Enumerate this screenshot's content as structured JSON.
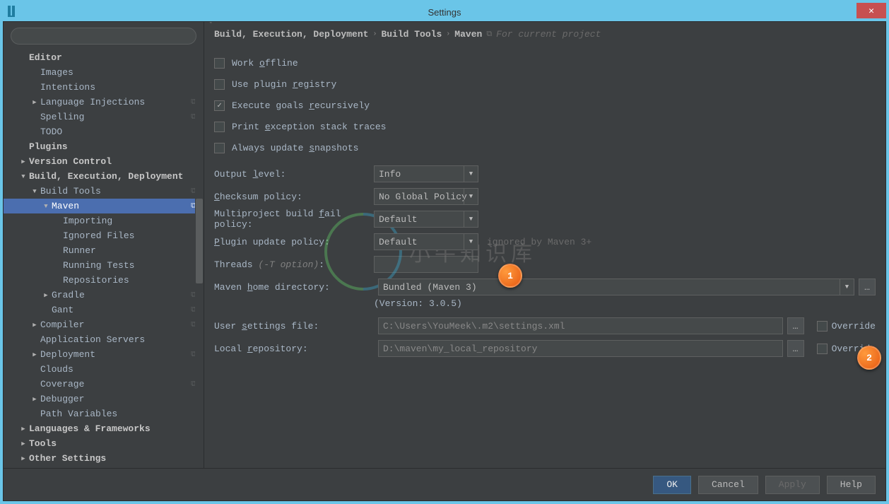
{
  "window": {
    "title": "Settings",
    "close": "✕"
  },
  "search": {
    "placeholder": ""
  },
  "tree": [
    {
      "indent": 1,
      "arrow": "",
      "label": "Editor",
      "bold": true
    },
    {
      "indent": 2,
      "arrow": "",
      "label": "Images"
    },
    {
      "indent": 2,
      "arrow": "",
      "label": "Intentions"
    },
    {
      "indent": 2,
      "arrow": "▶",
      "label": "Language Injections",
      "copy": true
    },
    {
      "indent": 2,
      "arrow": "",
      "label": "Spelling",
      "copy": true
    },
    {
      "indent": 2,
      "arrow": "",
      "label": "TODO"
    },
    {
      "indent": 1,
      "arrow": "",
      "label": "Plugins",
      "bold": true
    },
    {
      "indent": 1,
      "arrow": "▶",
      "label": "Version Control",
      "bold": true
    },
    {
      "indent": 1,
      "arrow": "▼",
      "label": "Build, Execution, Deployment",
      "bold": true
    },
    {
      "indent": 2,
      "arrow": "▼",
      "label": "Build Tools",
      "copy": true
    },
    {
      "indent": 3,
      "arrow": "▼",
      "label": "Maven",
      "copy": true,
      "selected": true
    },
    {
      "indent": 4,
      "arrow": "",
      "label": "Importing"
    },
    {
      "indent": 4,
      "arrow": "",
      "label": "Ignored Files"
    },
    {
      "indent": 4,
      "arrow": "",
      "label": "Runner"
    },
    {
      "indent": 4,
      "arrow": "",
      "label": "Running Tests"
    },
    {
      "indent": 4,
      "arrow": "",
      "label": "Repositories"
    },
    {
      "indent": 3,
      "arrow": "▶",
      "label": "Gradle",
      "copy": true
    },
    {
      "indent": 3,
      "arrow": "",
      "label": "Gant",
      "copy": true
    },
    {
      "indent": 2,
      "arrow": "▶",
      "label": "Compiler",
      "copy": true
    },
    {
      "indent": 2,
      "arrow": "",
      "label": "Application Servers"
    },
    {
      "indent": 2,
      "arrow": "▶",
      "label": "Deployment",
      "copy": true
    },
    {
      "indent": 2,
      "arrow": "",
      "label": "Clouds"
    },
    {
      "indent": 2,
      "arrow": "",
      "label": "Coverage",
      "copy": true
    },
    {
      "indent": 2,
      "arrow": "▶",
      "label": "Debugger"
    },
    {
      "indent": 2,
      "arrow": "",
      "label": "Path Variables"
    },
    {
      "indent": 1,
      "arrow": "▶",
      "label": "Languages & Frameworks",
      "bold": true
    },
    {
      "indent": 1,
      "arrow": "▶",
      "label": "Tools",
      "bold": true
    },
    {
      "indent": 1,
      "arrow": "▶",
      "label": "Other Settings",
      "bold": true
    }
  ],
  "breadcrumb": {
    "part1": "Build, Execution, Deployment",
    "part2": "Build Tools",
    "part3": "Maven",
    "hint": "For current project"
  },
  "checks": {
    "offline": "Work offline",
    "offline_u": "o",
    "registry": "Use plugin registry",
    "registry_u": "r",
    "recurse": "Execute goals recursively",
    "recurse_u": "r",
    "recurse_checked": true,
    "trace": "Print exception stack traces",
    "trace_u": "e",
    "snapshots": "Always update snapshots",
    "snapshots_u": "s"
  },
  "form": {
    "output_lbl": "Output level:",
    "output_u": "l",
    "output_val": "Info",
    "checksum_lbl": "Checksum policy:",
    "checksum_u": "C",
    "checksum_val": "No Global Policy",
    "multi_lbl": "Multiproject build fail policy:",
    "multi_u": "f",
    "multi_val": "Default",
    "plugin_lbl": "Plugin update policy:",
    "plugin_u": "P",
    "plugin_val": "Default",
    "plugin_hint": "ignored by Maven 3+",
    "threads_lbl": "Threads ",
    "threads_opt": "(-T option)",
    "threads_val": "",
    "home_lbl": "Maven home directory:",
    "home_u": "h",
    "home_val": "Bundled (Maven 3)",
    "version": "(Version: 3.0.5)",
    "user_lbl": "User settings file:",
    "user_u": "s",
    "user_val": "C:\\Users\\YouMeek\\.m2\\settings.xml",
    "repo_lbl": "Local repository:",
    "repo_u": "r",
    "repo_val": "D:\\maven\\my_local_repository",
    "override": "Override"
  },
  "callouts": {
    "c1": "1",
    "c2": "2"
  },
  "watermark": "小牛知识库",
  "buttons": {
    "ok": "OK",
    "cancel": "Cancel",
    "apply": "Apply",
    "help": "Help"
  }
}
